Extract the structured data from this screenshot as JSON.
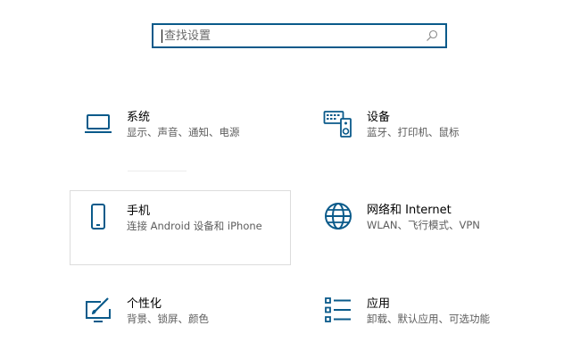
{
  "search": {
    "placeholder": "查找设置"
  },
  "tiles": [
    {
      "title": "系统",
      "desc": "显示、声音、通知、电源",
      "icon": "laptop-icon"
    },
    {
      "title": "设备",
      "desc": "蓝牙、打印机、鼠标",
      "icon": "keyboard-speaker-icon"
    },
    {
      "title": "手机",
      "desc": "连接 Android 设备和 iPhone",
      "icon": "phone-icon"
    },
    {
      "title": "网络和 Internet",
      "desc": "WLAN、飞行模式、VPN",
      "icon": "globe-icon"
    },
    {
      "title": "个性化",
      "desc": "背景、锁屏、颜色",
      "icon": "paint-monitor-icon"
    },
    {
      "title": "应用",
      "desc": "卸载、默认应用、可选功能",
      "icon": "apps-list-icon"
    }
  ],
  "colors": {
    "accent": "#0a5a8a",
    "icon": "#0a5a8a",
    "description": "#5d5d5d",
    "hover_border": "#dcdcdc"
  }
}
